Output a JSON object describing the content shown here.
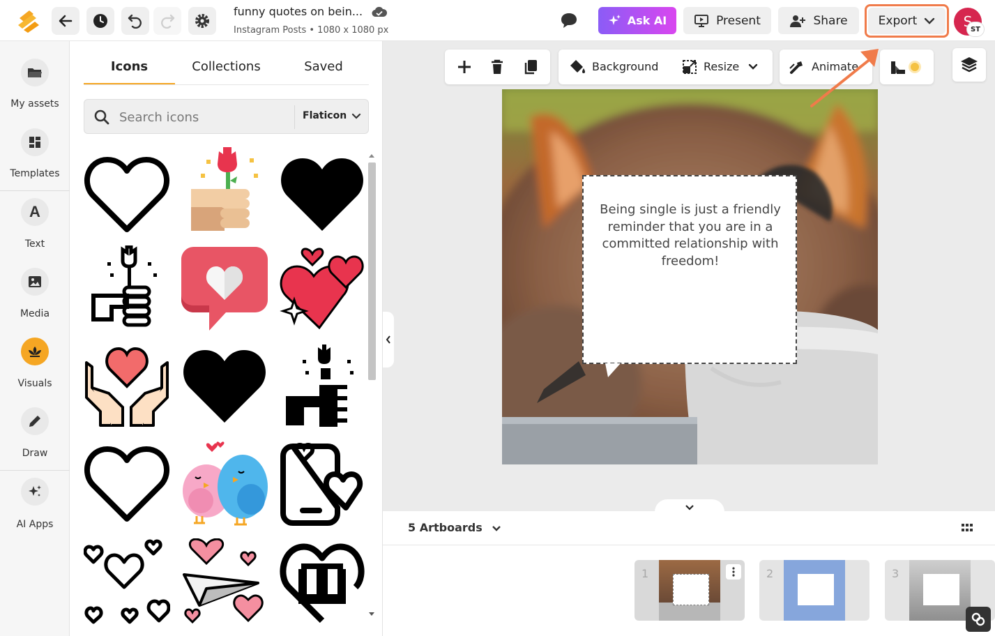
{
  "app": {
    "title": "funny quotes on bein...",
    "subtitle": "Instagram Posts • 1080 x 1080 px"
  },
  "topbar": {
    "ask_ai_label": "Ask AI",
    "present_label": "Present",
    "share_label": "Share",
    "export_label": "Export",
    "avatar_initial": "S",
    "avatar_badge": "ST"
  },
  "rail": {
    "items": [
      {
        "label": "My assets",
        "icon": "folder-icon"
      },
      {
        "label": "Templates",
        "icon": "templates-icon"
      },
      {
        "label": "Text",
        "icon": "text-icon",
        "glyph": "A"
      },
      {
        "label": "Media",
        "icon": "image-icon"
      },
      {
        "label": "Visuals",
        "icon": "visuals-icon",
        "active": true
      },
      {
        "label": "Draw",
        "icon": "pen-icon"
      },
      {
        "label": "AI Apps",
        "icon": "sparkle-icon"
      }
    ]
  },
  "panel": {
    "tabs": [
      "Icons",
      "Collections",
      "Saved"
    ],
    "active_tab": "Icons",
    "search_placeholder": "Search icons",
    "provider": "Flaticon",
    "icons": [
      "heart-outline-icon",
      "rose-hand-icon",
      "heart-filled-icon",
      "rose-hand-outline-icon",
      "heart-message-icon",
      "hearts-sparkle-icon",
      "heart-hands-icon",
      "heart-filled-icon",
      "rose-hand-filled-icon",
      "heart-outline-icon",
      "love-birds-icon",
      "phone-heart-icon",
      "scattered-hearts-icon",
      "paper-plane-hearts-icon",
      "heart-book-icon"
    ]
  },
  "toolbar": {
    "background_label": "Background",
    "resize_label": "Resize",
    "animate_label": "Animate"
  },
  "canvas": {
    "quote": "Being single is just a friendly reminder that you are in a committed relationship with freedom!"
  },
  "artboards": {
    "count_label": "5 Artboards",
    "thumbnails": [
      {
        "number": "1"
      },
      {
        "number": "2"
      },
      {
        "number": "3"
      }
    ]
  },
  "colors": {
    "accent": "#f5a623",
    "export_highlight": "#f07b4a",
    "ask_ai_start": "#8b5cf6",
    "ask_ai_end": "#d946ef",
    "avatar": "#d6264f"
  }
}
